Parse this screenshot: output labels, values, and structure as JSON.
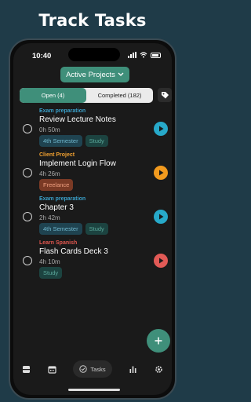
{
  "headline": "Track Tasks",
  "status": {
    "time": "10:40"
  },
  "project_selector": {
    "label": "Active Projects"
  },
  "tabs": [
    {
      "label": "Open (4)",
      "active": true
    },
    {
      "label": "Completed (182)",
      "active": false
    }
  ],
  "tasks": [
    {
      "project": "Exam preparation",
      "project_color": "#3aa0c9",
      "title": "Review Lecture Notes",
      "duration": "0h 50m",
      "tags": [
        "4th Semester",
        "Study"
      ],
      "play_color": "#27a9c9"
    },
    {
      "project": "Client Project",
      "project_color": "#f0a030",
      "title": "Implement Login Flow",
      "duration": "4h 26m",
      "tags": [
        "Freelance"
      ],
      "play_color": "#f29a1e"
    },
    {
      "project": "Exam preparation",
      "project_color": "#3aa0c9",
      "title": "Chapter 3",
      "duration": "2h 42m",
      "tags": [
        "4th Semester",
        "Study"
      ],
      "play_color": "#27a9c9"
    },
    {
      "project": "Learn Spanish",
      "project_color": "#e0574f",
      "title": "Flash Cards Deck 3",
      "duration": "4h 10m",
      "tags": [
        "Study"
      ],
      "play_color": "#e25a56"
    }
  ],
  "tag_colors": {
    "4th Semester": {
      "bg": "#1f4350",
      "fg": "#6fb6cc"
    },
    "Study": {
      "bg": "#1c4340",
      "fg": "#5aa89a"
    },
    "Freelance": {
      "bg": "#7a3a25",
      "fg": "#f0a080"
    }
  },
  "nav": {
    "active_label": "Tasks"
  },
  "colors": {
    "accent": "#3f8f7a"
  }
}
